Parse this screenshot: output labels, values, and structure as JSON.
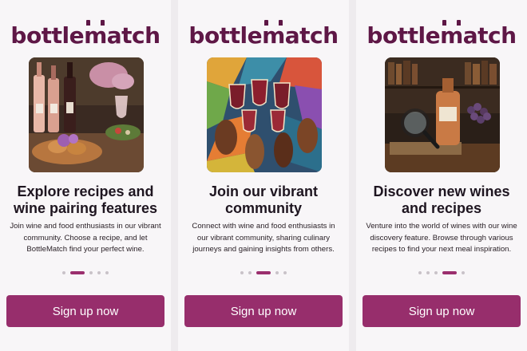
{
  "brand": {
    "logo_prefix": "bottle",
    "logo_m": "m",
    "logo_suffix": "atch",
    "color": "#5e1746"
  },
  "colors": {
    "accent": "#972e6c",
    "active_dot": "#9b2f6e",
    "inactive_dot": "#c9c2c8"
  },
  "screens": [
    {
      "image": "wine-bottles-and-food-platter-photo",
      "title": "Explore recipes and wine pairing features",
      "body": "Join wine and food enthusiasts in our vibrant community. Choose a recipe, and let BottleMatch find your perfect wine.",
      "active_dot": 2,
      "dot_count": 5,
      "button": "Sign up now"
    },
    {
      "image": "hands-toasting-wine-glasses-painting",
      "title": "Join our vibrant community",
      "body": "Connect with wine and food enthusiasts in our vibrant community, sharing culinary journeys and gaining insights from others.",
      "active_dot": 3,
      "dot_count": 5,
      "button": "Sign up now"
    },
    {
      "image": "magnifying-glass-bottle-and-grapes-photo",
      "title": "Discover new wines and recipes",
      "body": "Venture into the world of wines with our wine discovery feature. Browse through various recipes to find your next meal inspiration.",
      "active_dot": 4,
      "dot_count": 5,
      "button": "Sign up now"
    }
  ]
}
